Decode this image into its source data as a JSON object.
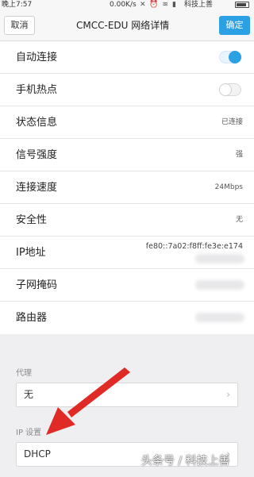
{
  "status_bar": {
    "time": "晚上7:57",
    "speed": "0.00K/s",
    "carrier": "科技上善",
    "icons": [
      "silent-icon",
      "alarm-icon",
      "wifi-icon",
      "signal-icon",
      "battery-icon"
    ]
  },
  "nav": {
    "cancel_label": "取消",
    "title": "CMCC-EDU  网络详情",
    "ok_label": "确定",
    "accent_color": "#2ba1e4"
  },
  "settings": {
    "auto_connect": {
      "label": "自动连接",
      "enabled": true
    },
    "hotspot": {
      "label": "手机热点",
      "enabled": false
    },
    "status": {
      "label": "状态信息",
      "value": "已连接"
    },
    "signal": {
      "label": "信号强度",
      "value": "强"
    },
    "speed": {
      "label": "连接速度",
      "value": "24Mbps"
    },
    "security": {
      "label": "安全性",
      "value": "无"
    },
    "ip": {
      "label": "IP地址",
      "value": "fe80::7a02:f8ff:fe3e:e174"
    },
    "subnet": {
      "label": "子网掩码"
    },
    "router": {
      "label": "路由器"
    }
  },
  "proxy": {
    "label": "代理",
    "value": "无"
  },
  "ip_settings": {
    "label": "IP 设置",
    "value": "DHCP"
  },
  "watermark": "头条号 / 科技上善"
}
